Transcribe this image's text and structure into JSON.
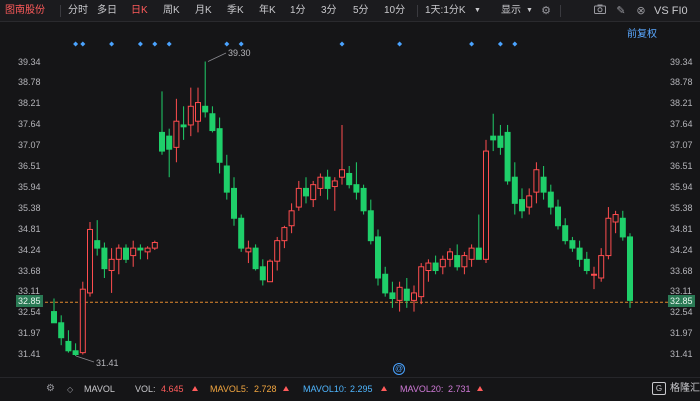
{
  "toolbar": {
    "stock_name": "图南股份",
    "periods": [
      "分时",
      "多日",
      "日K",
      "周K",
      "月K",
      "季K",
      "年K",
      "1分",
      "3分",
      "5分",
      "10分"
    ],
    "active_period": "日K",
    "multi_select": "1天:1分K",
    "display_label": "显示",
    "icons": [
      "settings-icon",
      "camera-icon",
      "edit-icon",
      "crosshair-icon"
    ],
    "compare_label": "VS FI0"
  },
  "chart": {
    "adjust_label": "前复权",
    "right_axis": [
      "39.34",
      "38.78",
      "38.21",
      "37.64",
      "37.07",
      "36.51",
      "35.94",
      "35.38",
      "34.81",
      "34.24",
      "33.68",
      "33.11",
      "32.54",
      "31.97",
      "31.41"
    ],
    "left_axis": [
      "39.34",
      "38.78",
      "38.21",
      "37.64",
      "37.07",
      "36.51",
      "35.94",
      "35.38",
      "34.81",
      "34.24",
      "33.68",
      "33.11",
      "32.54",
      "31.97",
      "31.41"
    ],
    "current_price": "32.85",
    "high_label": "39.30",
    "low_label": "31.41",
    "colors": {
      "up": "#ff4d4f",
      "down": "#1fcf6a",
      "line": "#e08a2e",
      "marker": "#4aa3ff"
    }
  },
  "chart_data": {
    "type": "candlestick",
    "ylim": [
      31.41,
      39.34
    ],
    "candles": [
      {
        "o": 32.6,
        "h": 32.95,
        "l": 32.3,
        "c": 32.3
      },
      {
        "o": 32.3,
        "h": 32.5,
        "l": 31.7,
        "c": 31.9
      },
      {
        "o": 31.8,
        "h": 32.1,
        "l": 31.5,
        "c": 31.55
      },
      {
        "o": 31.55,
        "h": 31.75,
        "l": 31.41,
        "c": 31.45
      },
      {
        "o": 31.5,
        "h": 33.4,
        "l": 31.45,
        "c": 33.2
      },
      {
        "o": 33.1,
        "h": 35.0,
        "l": 33.0,
        "c": 34.8
      },
      {
        "o": 34.5,
        "h": 35.05,
        "l": 34.1,
        "c": 34.3
      },
      {
        "o": 34.3,
        "h": 34.45,
        "l": 33.5,
        "c": 33.75
      },
      {
        "o": 33.7,
        "h": 34.3,
        "l": 33.1,
        "c": 34.0
      },
      {
        "o": 34.0,
        "h": 34.4,
        "l": 33.6,
        "c": 34.3
      },
      {
        "o": 34.3,
        "h": 34.4,
        "l": 33.9,
        "c": 34.0
      },
      {
        "o": 34.1,
        "h": 34.5,
        "l": 33.8,
        "c": 34.3
      },
      {
        "o": 34.3,
        "h": 34.4,
        "l": 34.0,
        "c": 34.25
      },
      {
        "o": 34.2,
        "h": 34.35,
        "l": 34.0,
        "c": 34.3
      },
      {
        "o": 34.3,
        "h": 34.5,
        "l": 34.25,
        "c": 34.45
      },
      {
        "o": 37.4,
        "h": 38.5,
        "l": 36.8,
        "c": 36.9
      },
      {
        "o": 37.3,
        "h": 37.5,
        "l": 36.2,
        "c": 36.95
      },
      {
        "o": 37.0,
        "h": 38.3,
        "l": 36.6,
        "c": 37.7
      },
      {
        "o": 37.6,
        "h": 38.1,
        "l": 37.2,
        "c": 37.55
      },
      {
        "o": 37.6,
        "h": 38.6,
        "l": 37.3,
        "c": 38.1
      },
      {
        "o": 37.7,
        "h": 38.6,
        "l": 37.4,
        "c": 38.2
      },
      {
        "o": 38.1,
        "h": 39.3,
        "l": 37.8,
        "c": 37.95
      },
      {
        "o": 37.9,
        "h": 38.1,
        "l": 37.4,
        "c": 37.45
      },
      {
        "o": 37.5,
        "h": 37.8,
        "l": 36.3,
        "c": 36.6
      },
      {
        "o": 36.5,
        "h": 36.8,
        "l": 35.6,
        "c": 35.8
      },
      {
        "o": 35.9,
        "h": 36.2,
        "l": 34.9,
        "c": 35.1
      },
      {
        "o": 35.1,
        "h": 35.2,
        "l": 34.2,
        "c": 34.3
      },
      {
        "o": 34.2,
        "h": 34.5,
        "l": 33.9,
        "c": 34.3
      },
      {
        "o": 34.3,
        "h": 34.4,
        "l": 33.7,
        "c": 33.75
      },
      {
        "o": 33.8,
        "h": 34.0,
        "l": 33.3,
        "c": 33.45
      },
      {
        "o": 33.4,
        "h": 34.0,
        "l": 33.4,
        "c": 33.95
      },
      {
        "o": 33.95,
        "h": 34.6,
        "l": 33.7,
        "c": 34.5
      },
      {
        "o": 34.5,
        "h": 34.9,
        "l": 34.3,
        "c": 34.85
      },
      {
        "o": 34.9,
        "h": 35.5,
        "l": 34.7,
        "c": 35.3
      },
      {
        "o": 35.4,
        "h": 36.1,
        "l": 35.3,
        "c": 35.9
      },
      {
        "o": 35.9,
        "h": 36.2,
        "l": 35.5,
        "c": 35.7
      },
      {
        "o": 35.6,
        "h": 36.1,
        "l": 35.4,
        "c": 36.0
      },
      {
        "o": 35.9,
        "h": 36.3,
        "l": 35.7,
        "c": 36.2
      },
      {
        "o": 36.2,
        "h": 36.4,
        "l": 35.6,
        "c": 35.9
      },
      {
        "o": 35.95,
        "h": 36.2,
        "l": 35.3,
        "c": 36.1
      },
      {
        "o": 36.2,
        "h": 37.6,
        "l": 36.0,
        "c": 36.4
      },
      {
        "o": 36.3,
        "h": 36.5,
        "l": 35.9,
        "c": 36.0
      },
      {
        "o": 36.0,
        "h": 36.6,
        "l": 35.6,
        "c": 35.8
      },
      {
        "o": 35.9,
        "h": 36.0,
        "l": 35.2,
        "c": 35.3
      },
      {
        "o": 35.3,
        "h": 35.6,
        "l": 34.4,
        "c": 34.5
      },
      {
        "o": 34.6,
        "h": 34.8,
        "l": 33.3,
        "c": 33.5
      },
      {
        "o": 33.6,
        "h": 33.8,
        "l": 33.0,
        "c": 33.1
      },
      {
        "o": 33.1,
        "h": 33.4,
        "l": 32.7,
        "c": 32.95
      },
      {
        "o": 32.9,
        "h": 33.4,
        "l": 32.6,
        "c": 33.25
      },
      {
        "o": 33.2,
        "h": 33.5,
        "l": 32.7,
        "c": 32.9
      },
      {
        "o": 32.9,
        "h": 33.3,
        "l": 32.6,
        "c": 33.1
      },
      {
        "o": 33.0,
        "h": 33.9,
        "l": 32.8,
        "c": 33.8
      },
      {
        "o": 33.7,
        "h": 34.0,
        "l": 33.4,
        "c": 33.9
      },
      {
        "o": 33.9,
        "h": 34.1,
        "l": 33.6,
        "c": 33.7
      },
      {
        "o": 33.8,
        "h": 34.1,
        "l": 33.6,
        "c": 34.0
      },
      {
        "o": 34.0,
        "h": 34.3,
        "l": 33.8,
        "c": 34.2
      },
      {
        "o": 34.1,
        "h": 34.4,
        "l": 33.7,
        "c": 33.8
      },
      {
        "o": 33.8,
        "h": 34.2,
        "l": 33.6,
        "c": 34.1
      },
      {
        "o": 34.0,
        "h": 34.4,
        "l": 33.8,
        "c": 34.3
      },
      {
        "o": 34.3,
        "h": 35.2,
        "l": 34.0,
        "c": 34.0
      },
      {
        "o": 34.0,
        "h": 37.2,
        "l": 33.9,
        "c": 36.9
      },
      {
        "o": 37.3,
        "h": 37.9,
        "l": 36.9,
        "c": 37.2
      },
      {
        "o": 37.3,
        "h": 37.6,
        "l": 36.8,
        "c": 37.0
      },
      {
        "o": 37.4,
        "h": 37.6,
        "l": 36.0,
        "c": 36.1
      },
      {
        "o": 36.2,
        "h": 36.6,
        "l": 35.2,
        "c": 35.5
      },
      {
        "o": 35.6,
        "h": 35.9,
        "l": 35.1,
        "c": 35.3
      },
      {
        "o": 35.4,
        "h": 35.9,
        "l": 35.2,
        "c": 35.7
      },
      {
        "o": 35.8,
        "h": 36.6,
        "l": 35.5,
        "c": 36.4
      },
      {
        "o": 36.2,
        "h": 36.5,
        "l": 35.6,
        "c": 35.8
      },
      {
        "o": 35.8,
        "h": 36.0,
        "l": 35.2,
        "c": 35.4
      },
      {
        "o": 35.4,
        "h": 35.6,
        "l": 34.8,
        "c": 34.9
      },
      {
        "o": 34.9,
        "h": 35.1,
        "l": 34.4,
        "c": 34.5
      },
      {
        "o": 34.5,
        "h": 34.6,
        "l": 34.2,
        "c": 34.3
      },
      {
        "o": 34.3,
        "h": 34.5,
        "l": 33.8,
        "c": 34.0
      },
      {
        "o": 34.0,
        "h": 34.2,
        "l": 33.6,
        "c": 33.7
      },
      {
        "o": 33.6,
        "h": 33.8,
        "l": 33.2,
        "c": 33.6
      },
      {
        "o": 33.5,
        "h": 34.3,
        "l": 33.4,
        "c": 34.1
      },
      {
        "o": 34.1,
        "h": 35.4,
        "l": 34.0,
        "c": 35.1
      },
      {
        "o": 35.0,
        "h": 35.3,
        "l": 34.7,
        "c": 35.2
      },
      {
        "o": 35.1,
        "h": 35.3,
        "l": 34.5,
        "c": 34.6
      },
      {
        "o": 34.6,
        "h": 34.7,
        "l": 32.7,
        "c": 32.9
      }
    ],
    "markers": [
      3,
      4,
      8,
      12,
      14,
      16,
      24,
      26,
      40,
      48,
      58,
      62,
      64
    ]
  },
  "footer": {
    "indicator": "MAVOL",
    "vol_label": "VOL:",
    "vol_value": "4.645",
    "mavol5_label": "MAVOL5:",
    "mavol5_value": "2.728",
    "mavol10_label": "MAVOL10:",
    "mavol10_value": "2.295",
    "mavol20_label": "MAVOL20:",
    "mavol20_value": "2.731",
    "brand": "格隆汇"
  }
}
